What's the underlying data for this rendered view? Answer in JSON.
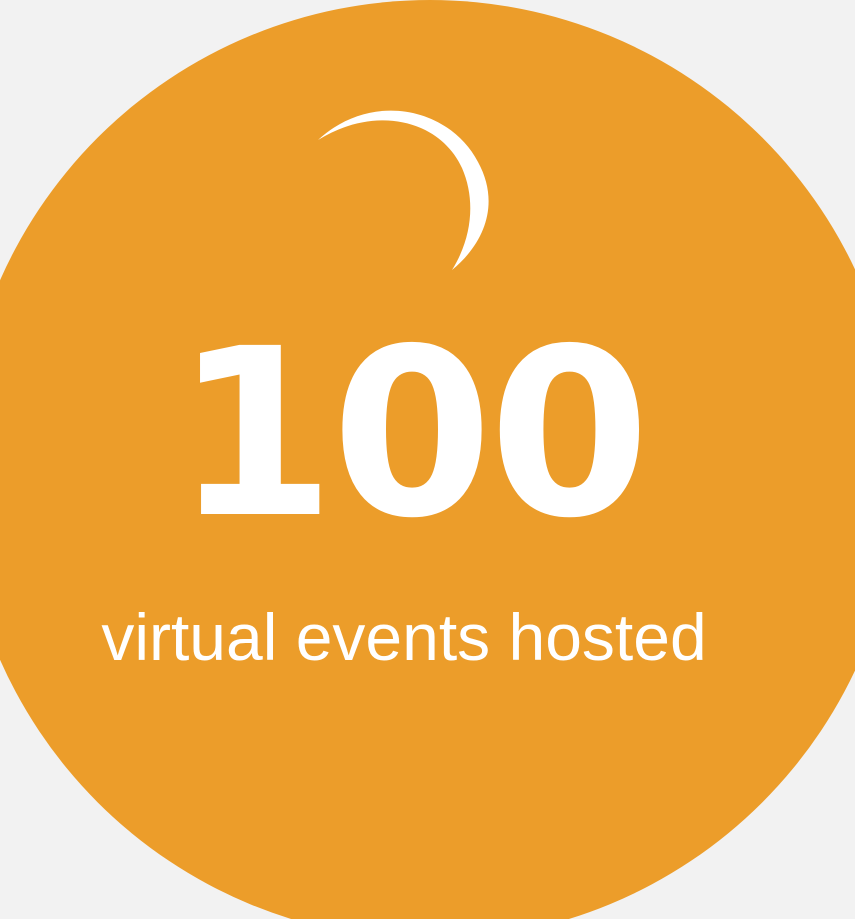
{
  "stat": {
    "value": "100",
    "label": "virtual events hosted"
  },
  "colors": {
    "background": "#f2f2f2",
    "circle": "#ec9d2a",
    "text": "#ffffff"
  },
  "icons": {
    "decoration": "crescent-moon-icon"
  }
}
